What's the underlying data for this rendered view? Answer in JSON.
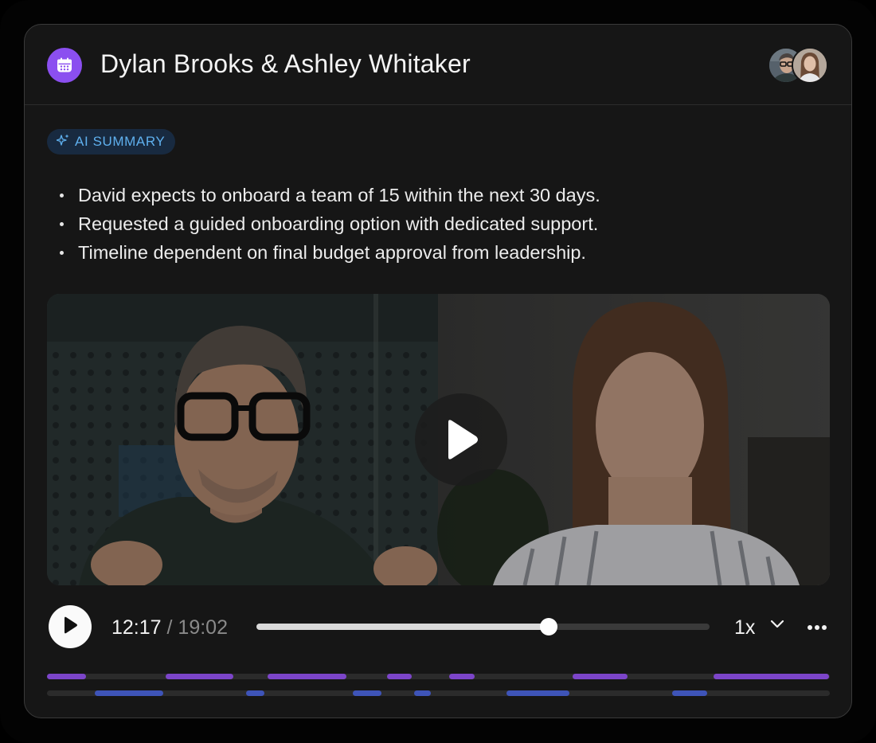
{
  "meeting": {
    "title": "Dylan Brooks & Ashley Whitaker",
    "participants": [
      "Dylan Brooks",
      "Ashley Whitaker"
    ]
  },
  "summary": {
    "badge_label": "AI SUMMARY",
    "bullets": [
      "David expects to onboard a team of 15 within the next 30 days.",
      "Requested a guided onboarding option with dedicated support.",
      "Timeline dependent on final budget approval from leadership."
    ]
  },
  "player": {
    "current_time": "12:17",
    "separator": "/",
    "total_time": "19:02",
    "progress": 0.6455,
    "speed_label": "1x"
  },
  "speaker_timeline": {
    "lane_1": [
      [
        0.0,
        0.05
      ],
      [
        0.152,
        0.238
      ],
      [
        0.282,
        0.383
      ],
      [
        0.434,
        0.466
      ],
      [
        0.514,
        0.546
      ],
      [
        0.671,
        0.742
      ],
      [
        0.851,
        0.999
      ]
    ],
    "lane_2": [
      [
        0.061,
        0.149
      ],
      [
        0.254,
        0.278
      ],
      [
        0.391,
        0.427
      ],
      [
        0.469,
        0.49
      ],
      [
        0.587,
        0.667
      ],
      [
        0.799,
        0.843
      ]
    ]
  },
  "colors": {
    "accent_purple": "#8b4ff0",
    "ai_badge_text": "#5fb0ee",
    "lane_1": "#7c45c9",
    "lane_2": "#3e54b8"
  },
  "icons": {
    "header": "calendar-icon",
    "ai_badge": "sparkle-icon",
    "video_play": "play-icon",
    "speed_menu": "chevron-down-icon",
    "more": "more-icon"
  }
}
